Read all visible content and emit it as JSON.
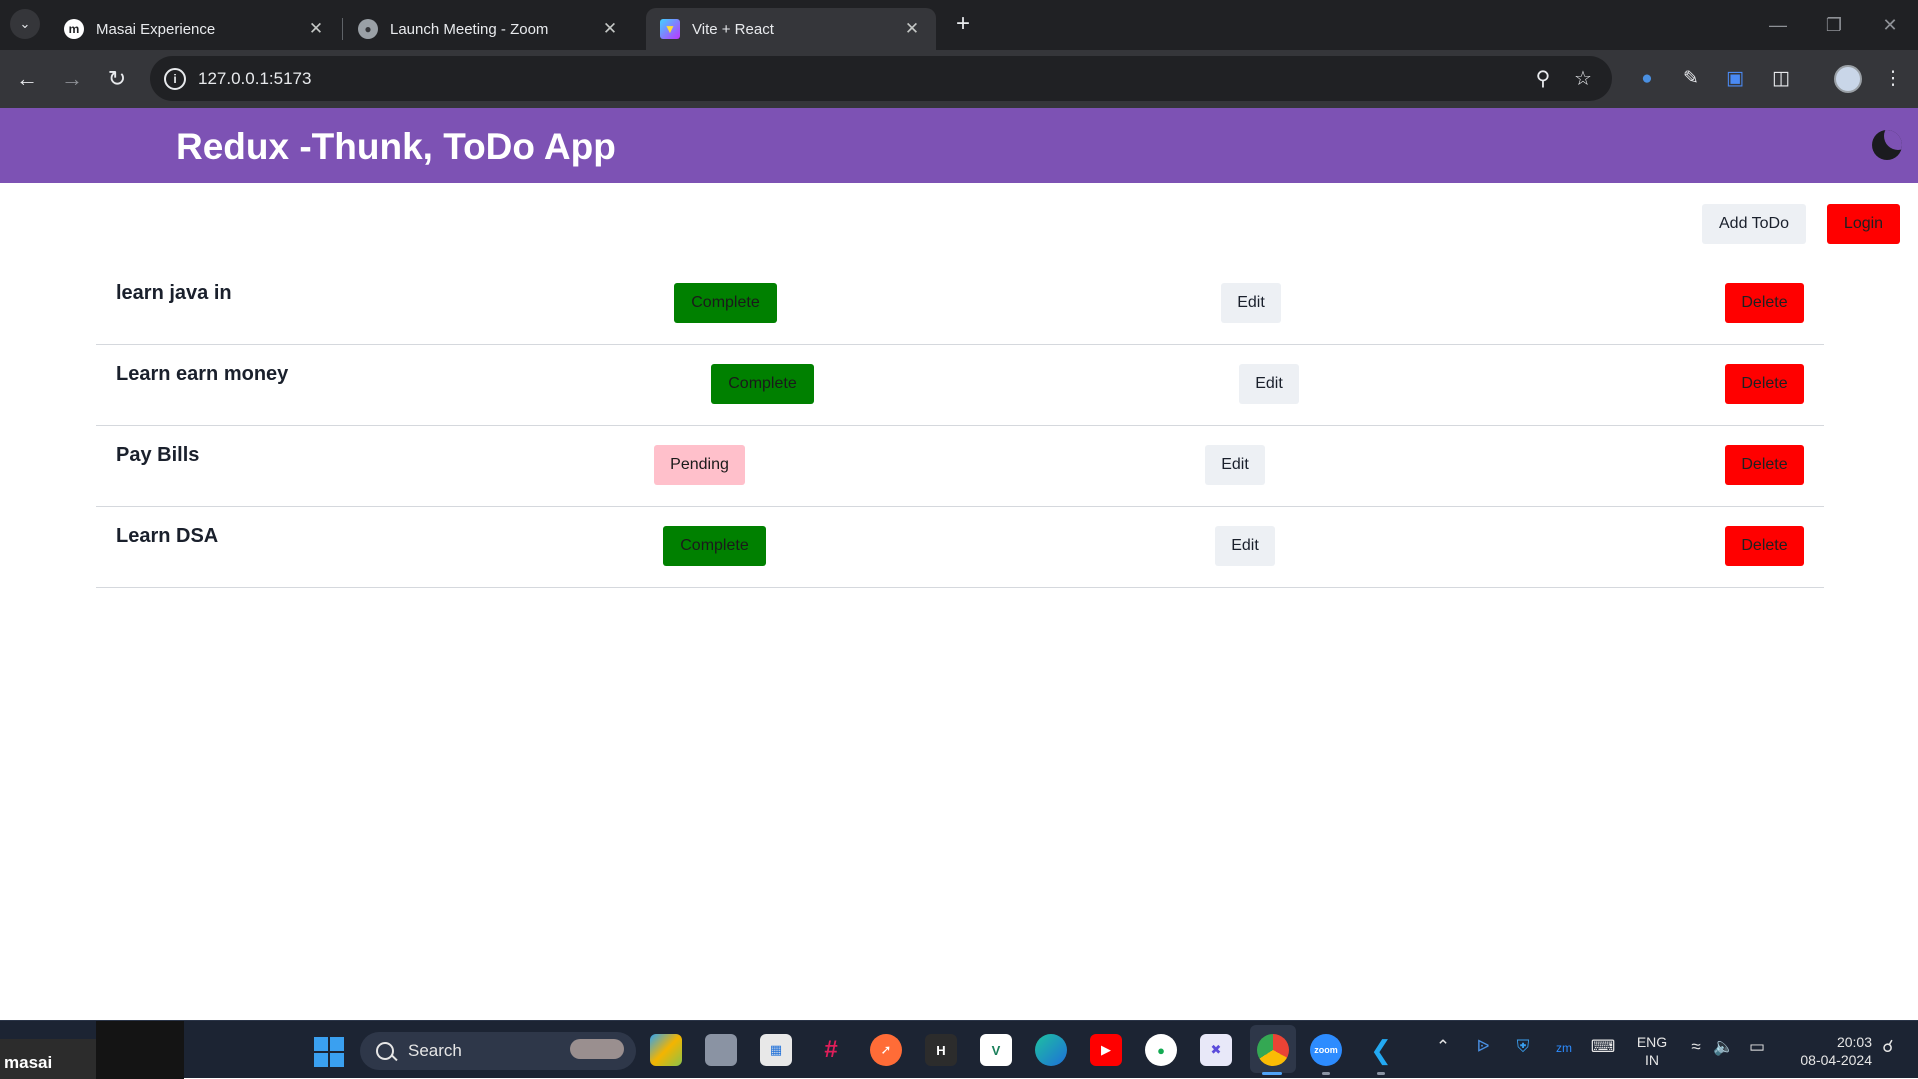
{
  "browser": {
    "tabs": [
      {
        "title": "Masai Experience",
        "favicon": "masai-favicon",
        "active": false
      },
      {
        "title": "Launch Meeting - Zoom",
        "favicon": "globe-icon",
        "active": false
      },
      {
        "title": "Vite + React",
        "favicon": "vite-favicon",
        "active": true
      }
    ],
    "url": "127.0.0.1:5173"
  },
  "app": {
    "title": "Redux -Thunk, ToDo App",
    "theme_toggle_icon": "moon-icon",
    "colors": {
      "header_bg": "#7d52b4",
      "complete": "#008000",
      "pending": "#ffc0cb",
      "delete": "#ff0000",
      "login": "#ff0000",
      "neutral_button": "#edf0f4"
    },
    "actions": {
      "add_todo": "Add ToDo",
      "login": "Login"
    },
    "todos": [
      {
        "title": "learn java in",
        "status": "Complete",
        "edit": "Edit",
        "delete": "Delete"
      },
      {
        "title": "Learn earn money",
        "status": "Complete",
        "edit": "Edit",
        "delete": "Delete"
      },
      {
        "title": "Pay Bills",
        "status": "Pending",
        "edit": "Edit",
        "delete": "Delete"
      },
      {
        "title": "Learn DSA",
        "status": "Complete",
        "edit": "Edit",
        "delete": "Delete"
      }
    ]
  },
  "taskbar": {
    "search_label": "Search",
    "thumbnail_text": "masai",
    "language": "ENG",
    "region": "IN",
    "time": "20:03",
    "date": "08-04-2024",
    "apps": [
      "copilot-icon",
      "file-explorer-icon",
      "microsoft-store-icon",
      "slack-icon",
      "postman-icon",
      "hashnode-icon",
      "vuetify-icon",
      "edge-icon",
      "youtube-icon",
      "mongodb-compass-icon",
      "xmind-icon",
      "chrome-icon",
      "zoom-icon",
      "vscode-icon"
    ]
  }
}
